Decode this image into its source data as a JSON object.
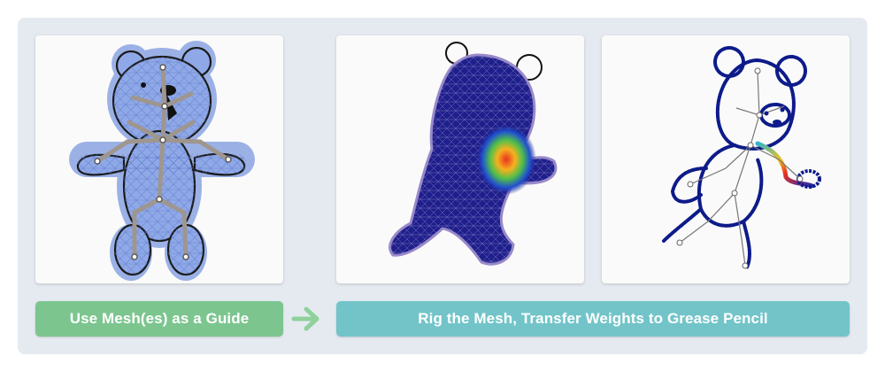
{
  "steps": [
    {
      "label": "Use Mesh(es) as a Guide"
    },
    {
      "label": "Rig the Mesh, Transfer Weights to Grease Pencil"
    }
  ],
  "colors": {
    "frame_bg": "#e5eaf1",
    "step1_bg": "#7cc58f",
    "step2_bg": "#72c4c9",
    "arrow": "#8fd19b",
    "mesh_fill": "#8fa9e8",
    "bone": "#9e968f",
    "weight_base": "#1f1f8c",
    "stroke_navy": "#0d1b8a"
  },
  "icons": [
    "right-arrow-icon"
  ],
  "panels": [
    {
      "name": "mesh-guide-bear"
    },
    {
      "name": "weight-painted-bear"
    },
    {
      "name": "grease-pencil-bear"
    }
  ]
}
